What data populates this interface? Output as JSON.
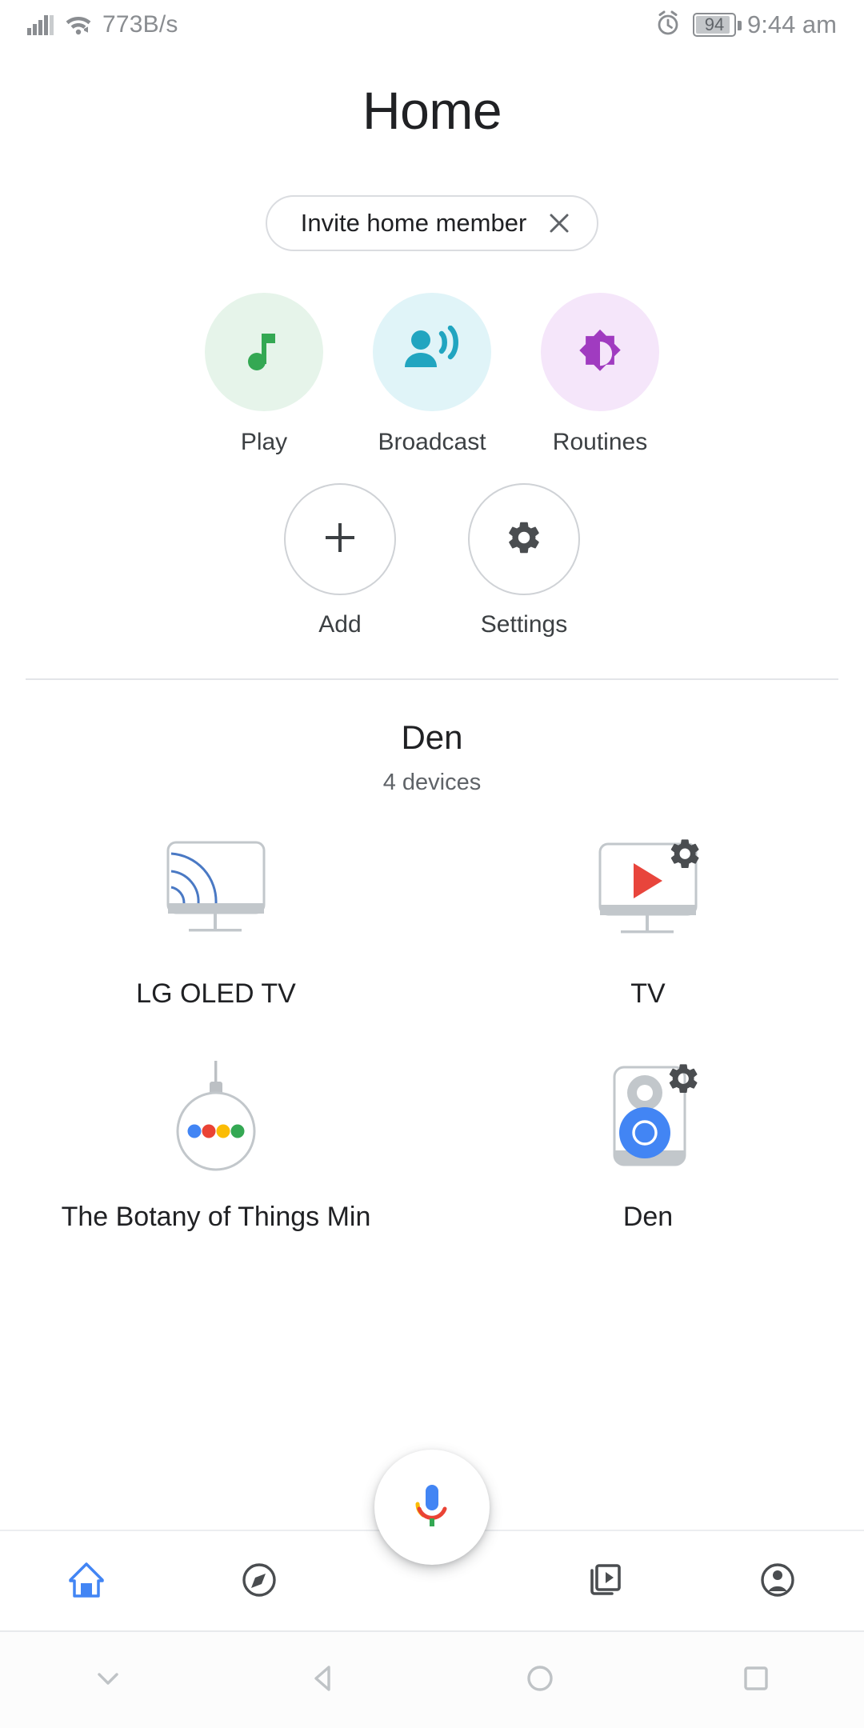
{
  "status_bar": {
    "network_speed": "773B/s",
    "signal_icon": "cellular-signal-icon",
    "wifi_icon": "wifi-icon",
    "alarm_icon": "alarm-clock-icon",
    "battery_level": "94",
    "battery_icon": "battery-icon",
    "time": "9:44 am"
  },
  "header": {
    "title": "Home"
  },
  "invite_chip": {
    "label": "Invite home member",
    "close_icon": "close-icon"
  },
  "quick_actions": [
    {
      "label": "Play",
      "icon": "music-note-icon",
      "icon_color": "#34a853",
      "bubble_color": "#e6f4ea"
    },
    {
      "label": "Broadcast",
      "icon": "broadcast-icon",
      "icon_color": "#21a5c0",
      "bubble_color": "#e0f4f8"
    },
    {
      "label": "Routines",
      "icon": "brightness-starburst-icon",
      "icon_color": "#a03bc0",
      "bubble_color": "#f5e6fa"
    }
  ],
  "actions": [
    {
      "label": "Add",
      "icon": "plus-icon"
    },
    {
      "label": "Settings",
      "icon": "gear-icon"
    }
  ],
  "room": {
    "name": "Den",
    "device_count_label": "4 devices"
  },
  "devices": [
    {
      "label": "LG OLED TV",
      "icon": "cast-tv-icon",
      "has_settings_badge": false
    },
    {
      "label": "TV",
      "icon": "tv-play-icon",
      "has_settings_badge": true
    },
    {
      "label": "The Botany of Things Min",
      "icon": "home-mini-icon",
      "has_settings_badge": false
    },
    {
      "label": "Den",
      "icon": "speaker-icon",
      "has_settings_badge": true
    }
  ],
  "assistant_fab": {
    "icon": "google-assistant-mic-icon"
  },
  "bottom_nav": [
    {
      "label": "Home",
      "icon": "home-icon",
      "active": true
    },
    {
      "label": "Explore",
      "icon": "compass-icon",
      "active": false
    },
    {
      "label": "Media",
      "icon": "media-icon",
      "active": false
    },
    {
      "label": "Account",
      "icon": "account-icon",
      "active": false
    }
  ],
  "system_nav": [
    {
      "label": "Hide keyboard",
      "icon": "chevron-down-icon"
    },
    {
      "label": "Back",
      "icon": "back-triangle-icon"
    },
    {
      "label": "Home",
      "icon": "home-circle-icon"
    },
    {
      "label": "Recents",
      "icon": "recents-square-icon"
    }
  ],
  "colors": {
    "accent_blue": "#4285f4",
    "google_red": "#ea4335",
    "google_yellow": "#fbbc04",
    "google_green": "#34a853"
  }
}
